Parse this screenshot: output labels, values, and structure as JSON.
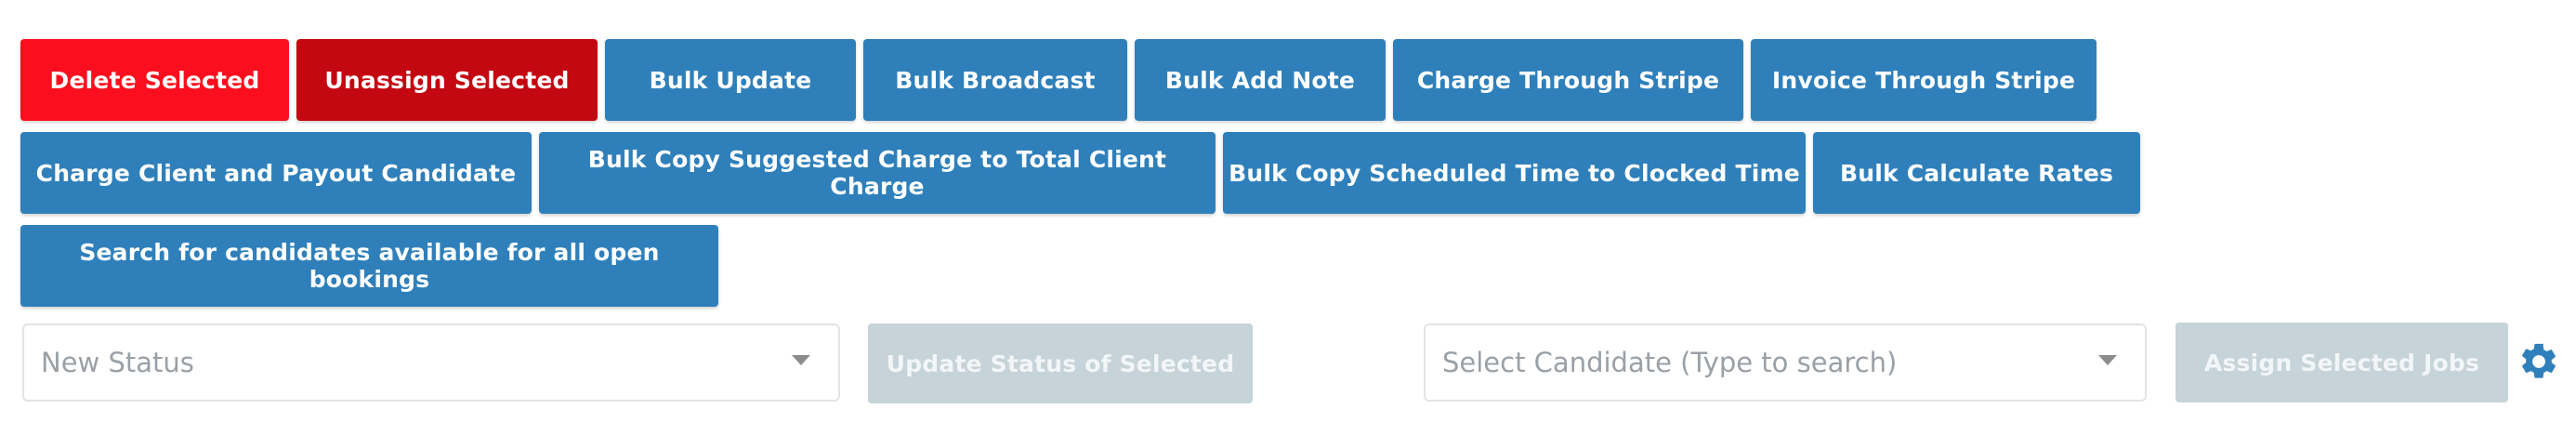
{
  "bulk_actions": {
    "delete_selected": "Delete Selected",
    "unassign_selected": "Unassign Selected",
    "bulk_update": "Bulk Update",
    "bulk_broadcast": "Bulk Broadcast",
    "bulk_add_note": "Bulk Add Note",
    "charge_through_stripe": "Charge Through Stripe",
    "invoice_through_stripe": "Invoice Through Stripe",
    "charge_client_payout": "Charge Client and Payout Candidate",
    "bulk_copy_suggested_charge": "Bulk Copy Suggested Charge to Total Client Charge",
    "bulk_copy_scheduled_time": "Bulk Copy Scheduled Time to Clocked Time",
    "bulk_calculate_rates": "Bulk Calculate Rates",
    "search_candidates": "Search for candidates available for all open bookings"
  },
  "status_form": {
    "status_placeholder": "New Status",
    "update_button": "Update Status of Selected"
  },
  "assign_form": {
    "candidate_placeholder": "Select Candidate (Type to search)",
    "assign_button": "Assign Selected Jobs"
  },
  "icons": {
    "settings": "gear-icon",
    "dropdown": "chevron-down-icon"
  },
  "colors": {
    "danger": "#fb0f1e",
    "dark_danger": "#c40812",
    "primary": "#2f80ba",
    "disabled": "#c6d3d8",
    "gear": "#2f80ba"
  }
}
